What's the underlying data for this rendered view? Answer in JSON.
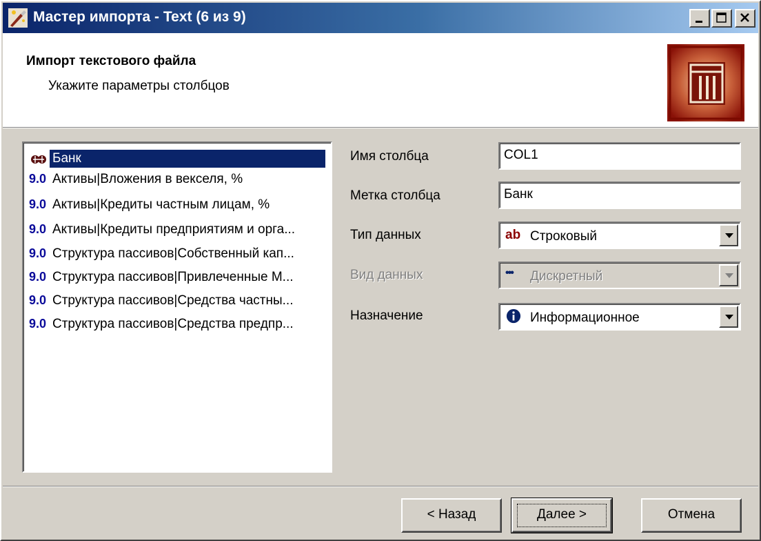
{
  "window": {
    "title": "Мастер импорта - Text (6 из 9)",
    "controls": {
      "minimize": "minimize",
      "maximize": "maximize",
      "close": "close"
    }
  },
  "header": {
    "title": "Импорт текстового файла",
    "subtitle": "Укажите параметры столбцов",
    "logo_icon": "table-import-icon"
  },
  "columns": {
    "items": [
      {
        "icon": "string-type-icon",
        "prefix": "",
        "label": "Банк",
        "selected": true
      },
      {
        "icon": "numeric-type-icon",
        "prefix": "9.0",
        "label": "Активы|Вложения в векселя, %",
        "selected": false
      },
      {
        "icon": "numeric-type-icon",
        "prefix": "9.0",
        "label": "Активы|Кредиты частным лицам, %",
        "selected": false
      },
      {
        "icon": "numeric-type-icon",
        "prefix": "9.0",
        "label": "Активы|Кредиты предприятиям и орга...",
        "selected": false
      },
      {
        "icon": "numeric-type-icon",
        "prefix": "9.0",
        "label": "Структура пассивов|Собственный кап...",
        "selected": false
      },
      {
        "icon": "numeric-type-icon",
        "prefix": "9.0",
        "label": "Структура пассивов|Привлеченные М...",
        "selected": false
      },
      {
        "icon": "numeric-type-icon",
        "prefix": "9.0",
        "label": "Структура пассивов|Средства частны...",
        "selected": false
      },
      {
        "icon": "numeric-type-icon",
        "prefix": "9.0",
        "label": "Структура пассивов|Средства предпр...",
        "selected": false
      }
    ]
  },
  "form": {
    "column_name": {
      "label": "Имя столбца",
      "value": "COL1"
    },
    "column_label": {
      "label": "Метка столбца",
      "value": "Банк"
    },
    "data_type": {
      "label": "Тип данных",
      "icon_text": "ab",
      "value": "Строковый",
      "icon_color": "#8b0000"
    },
    "data_kind": {
      "label": "Вид данных",
      "icon_text": "•••",
      "value": "Дискретный",
      "disabled": true
    },
    "purpose": {
      "label": "Назначение",
      "icon_text": "i",
      "value": "Информационное",
      "icon_color": "#0a246a"
    }
  },
  "buttons": {
    "back": "< Назад",
    "next": "Далее >",
    "cancel": "Отмена"
  },
  "colors": {
    "selection": "#0a246a",
    "face": "#d4d0c8",
    "logo": "#9a1a10"
  }
}
